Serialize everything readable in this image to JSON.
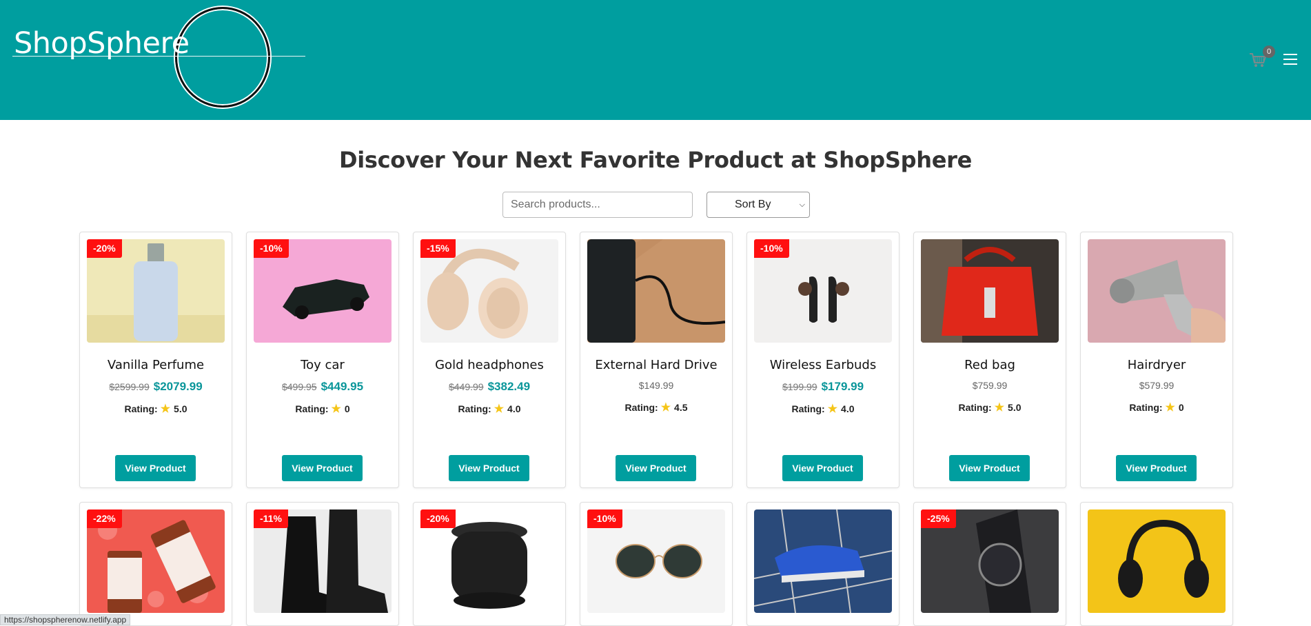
{
  "header": {
    "brand": "ShopSphere",
    "cart_count": "0",
    "cart_icon": "cart-icon",
    "menu_icon": "hamburger-menu-icon",
    "bg_color": "#009e9f"
  },
  "hero": {
    "title": "Discover Your Next Favorite Product at ShopSphere"
  },
  "controls": {
    "search_placeholder": "Search products...",
    "sort_label": "Sort By"
  },
  "products": [
    {
      "name": "Vanilla Perfume",
      "discount": "-20%",
      "old_price": "$2599.99",
      "price": "$2079.99",
      "rating_label": "Rating:",
      "rating": "5.0",
      "button": "View Product"
    },
    {
      "name": "Toy car",
      "discount": "-10%",
      "old_price": "$499.95",
      "price": "$449.95",
      "rating_label": "Rating:",
      "rating": "0",
      "button": "View Product"
    },
    {
      "name": "Gold headphones",
      "discount": "-15%",
      "old_price": "$449.99",
      "price": "$382.49",
      "rating_label": "Rating:",
      "rating": "4.0",
      "button": "View Product"
    },
    {
      "name": "External Hard Drive",
      "discount": "",
      "old_price": "",
      "price": "$149.99",
      "rating_label": "Rating:",
      "rating": "4.5",
      "button": "View Product"
    },
    {
      "name": "Wireless Earbuds",
      "discount": "-10%",
      "old_price": "$199.99",
      "price": "$179.99",
      "rating_label": "Rating:",
      "rating": "4.0",
      "button": "View Product"
    },
    {
      "name": "Red bag",
      "discount": "",
      "old_price": "",
      "price": "$759.99",
      "rating_label": "Rating:",
      "rating": "5.0",
      "button": "View Product"
    },
    {
      "name": "Hairdryer",
      "discount": "",
      "old_price": "",
      "price": "$579.99",
      "rating_label": "Rating:",
      "rating": "0",
      "button": "View Product"
    },
    {
      "discount": "-22%"
    },
    {
      "discount": "-11%"
    },
    {
      "discount": "-20%"
    },
    {
      "discount": "-10%"
    },
    {
      "discount": ""
    },
    {
      "discount": "-25%"
    },
    {
      "discount": ""
    }
  ],
  "status_bar": {
    "url": "https://shopspherenow.netlify.app"
  }
}
